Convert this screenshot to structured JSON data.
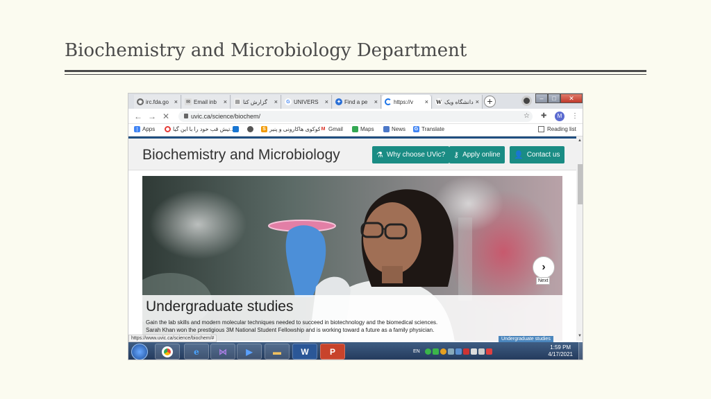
{
  "slide": {
    "title": "Biochemistry and Microbiology Department"
  },
  "browser": {
    "tabs": [
      {
        "label": "irc.fda.go",
        "icon": "globe-icon",
        "active": false
      },
      {
        "label": "Email inb",
        "icon": "mail-icon",
        "active": false
      },
      {
        "label": "گزارش کتا",
        "icon": "doc-icon",
        "active": false
      },
      {
        "label": "UNIVERS",
        "icon": "google-icon",
        "active": false
      },
      {
        "label": "Find a pe",
        "icon": "person-icon",
        "active": false
      },
      {
        "label": "https://v",
        "icon": "loading-icon",
        "active": true
      },
      {
        "label": "دانشگاه ویک",
        "icon": "wikipedia-icon",
        "active": false
      }
    ],
    "address": "uvic.ca/science/biochem/",
    "bookmarks": [
      {
        "label": "Apps",
        "icon": "apps-icon"
      },
      {
        "label": "تیش قب خود را با این گیا...",
        "icon": "target-icon"
      },
      {
        "label": "",
        "icon": "bookmark-blue-icon"
      },
      {
        "label": "",
        "icon": "chrome-icon"
      },
      {
        "label": "کوکوی هاکارونی و پنیر",
        "icon": "s-icon"
      },
      {
        "label": "Gmail",
        "icon": "gmail-icon"
      },
      {
        "label": "Maps",
        "icon": "maps-icon"
      },
      {
        "label": "News",
        "icon": "news-icon"
      },
      {
        "label": "Translate",
        "icon": "translate-icon"
      }
    ],
    "reading_list": "Reading list",
    "status_url": "https://www.uvic.ca/science/biochem/#"
  },
  "page": {
    "site_title": "Biochemistry and Microbiology",
    "buttons": [
      {
        "label": "Why choose UVic?",
        "icon": "flask-icon"
      },
      {
        "label": "Apply online",
        "icon": "key-icon"
      },
      {
        "label": "Contact us",
        "icon": "person-icon"
      }
    ],
    "hero": {
      "heading": "Undergraduate studies",
      "line1": "Gain the lab skills and modern molecular techniques needed to succeed in biotechnology and the biomedical sciences.",
      "line2": "Sarah Khan won the prestigious 3M National Student Fellowship and is working toward a future as a family physician.",
      "next_label": "Next",
      "slide_tag": "Undergraduate studies"
    }
  },
  "taskbar": {
    "apps": [
      "chrome-icon",
      "ie-icon",
      "visual-studio-icon",
      "media-icon",
      "folder-icon",
      "word-icon",
      "powerpoint-icon"
    ],
    "lang": "EN",
    "time": "1:59 PM",
    "date": "4/17/2021"
  },
  "colors": {
    "accent_teal": "#1a8c84",
    "title_gray": "#4a4a4a",
    "slide_bg": "#fbfbf0"
  }
}
